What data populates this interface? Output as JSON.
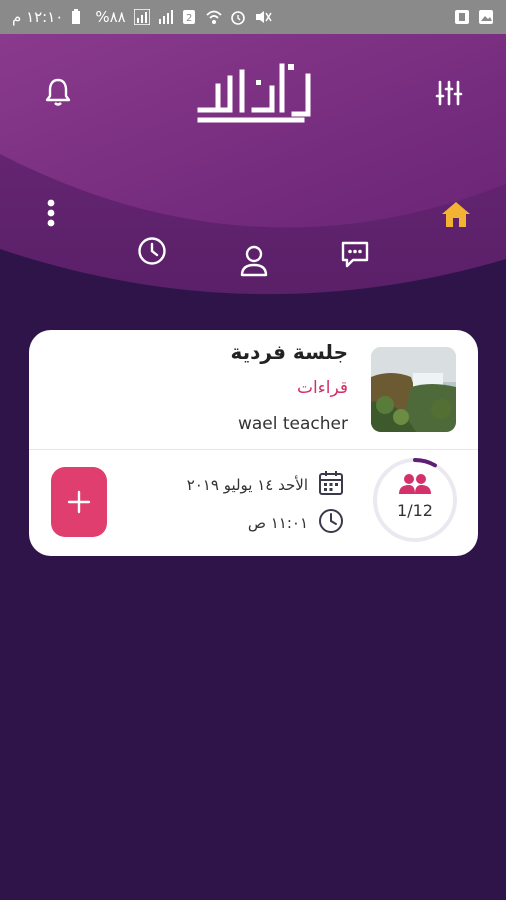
{
  "status_bar": {
    "time": "١٢:١٠ م",
    "battery": "%٨٨"
  },
  "header": {
    "logo_text": "إجلال",
    "icons": {
      "notifications": "bell-icon",
      "filters": "sliders-icon",
      "menu": "more-vertical-icon",
      "home": "home-icon",
      "history": "clock-icon",
      "profile": "user-icon",
      "messages": "chat-icon"
    }
  },
  "card": {
    "title": "جلسة فردية",
    "category": "قراءات",
    "teacher": "wael teacher",
    "date": "الأحد ١٤ يوليو ٢٠١٩",
    "time": "١١:٠١ ص",
    "attendees": "1/12",
    "attendance_fraction": 0.083,
    "add_label": "+"
  },
  "colors": {
    "background": "#2e1448",
    "header_top": "#7a2d82",
    "accent_home": "#f2b233",
    "category": "#d4306a",
    "add_button": "#e03e6e"
  }
}
